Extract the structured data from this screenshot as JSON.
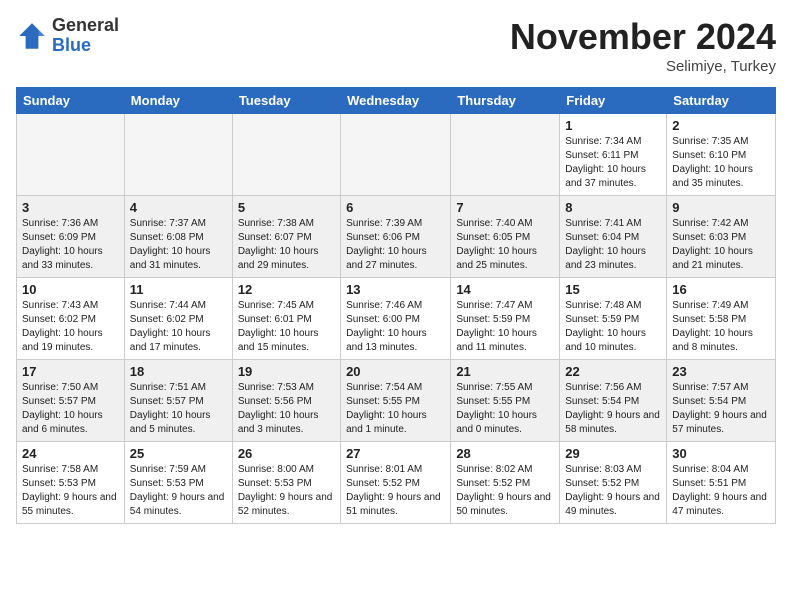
{
  "logo": {
    "general": "General",
    "blue": "Blue"
  },
  "header": {
    "month": "November 2024",
    "location": "Selimiye, Turkey"
  },
  "days_of_week": [
    "Sunday",
    "Monday",
    "Tuesday",
    "Wednesday",
    "Thursday",
    "Friday",
    "Saturday"
  ],
  "weeks": [
    [
      {
        "day": "",
        "empty": true
      },
      {
        "day": "",
        "empty": true
      },
      {
        "day": "",
        "empty": true
      },
      {
        "day": "",
        "empty": true
      },
      {
        "day": "",
        "empty": true
      },
      {
        "day": "1",
        "info": "Sunrise: 7:34 AM\nSunset: 6:11 PM\nDaylight: 10 hours\nand 37 minutes."
      },
      {
        "day": "2",
        "info": "Sunrise: 7:35 AM\nSunset: 6:10 PM\nDaylight: 10 hours\nand 35 minutes."
      }
    ],
    [
      {
        "day": "3",
        "info": "Sunrise: 7:36 AM\nSunset: 6:09 PM\nDaylight: 10 hours\nand 33 minutes."
      },
      {
        "day": "4",
        "info": "Sunrise: 7:37 AM\nSunset: 6:08 PM\nDaylight: 10 hours\nand 31 minutes."
      },
      {
        "day": "5",
        "info": "Sunrise: 7:38 AM\nSunset: 6:07 PM\nDaylight: 10 hours\nand 29 minutes."
      },
      {
        "day": "6",
        "info": "Sunrise: 7:39 AM\nSunset: 6:06 PM\nDaylight: 10 hours\nand 27 minutes."
      },
      {
        "day": "7",
        "info": "Sunrise: 7:40 AM\nSunset: 6:05 PM\nDaylight: 10 hours\nand 25 minutes."
      },
      {
        "day": "8",
        "info": "Sunrise: 7:41 AM\nSunset: 6:04 PM\nDaylight: 10 hours\nand 23 minutes."
      },
      {
        "day": "9",
        "info": "Sunrise: 7:42 AM\nSunset: 6:03 PM\nDaylight: 10 hours\nand 21 minutes."
      }
    ],
    [
      {
        "day": "10",
        "info": "Sunrise: 7:43 AM\nSunset: 6:02 PM\nDaylight: 10 hours\nand 19 minutes."
      },
      {
        "day": "11",
        "info": "Sunrise: 7:44 AM\nSunset: 6:02 PM\nDaylight: 10 hours\nand 17 minutes."
      },
      {
        "day": "12",
        "info": "Sunrise: 7:45 AM\nSunset: 6:01 PM\nDaylight: 10 hours\nand 15 minutes."
      },
      {
        "day": "13",
        "info": "Sunrise: 7:46 AM\nSunset: 6:00 PM\nDaylight: 10 hours\nand 13 minutes."
      },
      {
        "day": "14",
        "info": "Sunrise: 7:47 AM\nSunset: 5:59 PM\nDaylight: 10 hours\nand 11 minutes."
      },
      {
        "day": "15",
        "info": "Sunrise: 7:48 AM\nSunset: 5:59 PM\nDaylight: 10 hours\nand 10 minutes."
      },
      {
        "day": "16",
        "info": "Sunrise: 7:49 AM\nSunset: 5:58 PM\nDaylight: 10 hours\nand 8 minutes."
      }
    ],
    [
      {
        "day": "17",
        "info": "Sunrise: 7:50 AM\nSunset: 5:57 PM\nDaylight: 10 hours\nand 6 minutes."
      },
      {
        "day": "18",
        "info": "Sunrise: 7:51 AM\nSunset: 5:57 PM\nDaylight: 10 hours\nand 5 minutes."
      },
      {
        "day": "19",
        "info": "Sunrise: 7:53 AM\nSunset: 5:56 PM\nDaylight: 10 hours\nand 3 minutes."
      },
      {
        "day": "20",
        "info": "Sunrise: 7:54 AM\nSunset: 5:55 PM\nDaylight: 10 hours\nand 1 minute."
      },
      {
        "day": "21",
        "info": "Sunrise: 7:55 AM\nSunset: 5:55 PM\nDaylight: 10 hours\nand 0 minutes."
      },
      {
        "day": "22",
        "info": "Sunrise: 7:56 AM\nSunset: 5:54 PM\nDaylight: 9 hours\nand 58 minutes."
      },
      {
        "day": "23",
        "info": "Sunrise: 7:57 AM\nSunset: 5:54 PM\nDaylight: 9 hours\nand 57 minutes."
      }
    ],
    [
      {
        "day": "24",
        "info": "Sunrise: 7:58 AM\nSunset: 5:53 PM\nDaylight: 9 hours\nand 55 minutes."
      },
      {
        "day": "25",
        "info": "Sunrise: 7:59 AM\nSunset: 5:53 PM\nDaylight: 9 hours\nand 54 minutes."
      },
      {
        "day": "26",
        "info": "Sunrise: 8:00 AM\nSunset: 5:53 PM\nDaylight: 9 hours\nand 52 minutes."
      },
      {
        "day": "27",
        "info": "Sunrise: 8:01 AM\nSunset: 5:52 PM\nDaylight: 9 hours\nand 51 minutes."
      },
      {
        "day": "28",
        "info": "Sunrise: 8:02 AM\nSunset: 5:52 PM\nDaylight: 9 hours\nand 50 minutes."
      },
      {
        "day": "29",
        "info": "Sunrise: 8:03 AM\nSunset: 5:52 PM\nDaylight: 9 hours\nand 49 minutes."
      },
      {
        "day": "30",
        "info": "Sunrise: 8:04 AM\nSunset: 5:51 PM\nDaylight: 9 hours\nand 47 minutes."
      }
    ]
  ]
}
